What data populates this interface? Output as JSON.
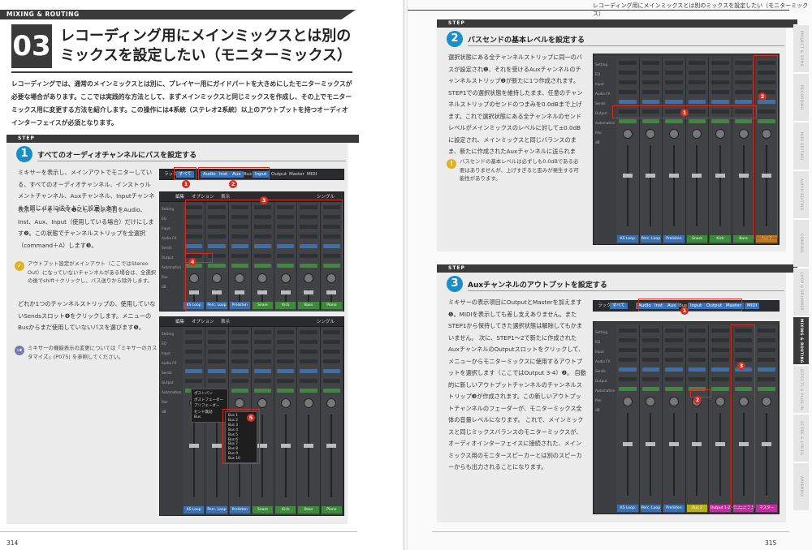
{
  "left_page": {
    "section_label": "MIXING & ROUTING",
    "number": "03",
    "title_line1": "レコーディング用にメインミックスとは別の",
    "title_line2": "ミックスを設定したい（モニターミックス）",
    "intro": "レコーディングでは、通常のメインミックスとは別に、プレイヤー用にガイドパートを大きめにしたモニターミックスが必要な場合があります。ここでは実践的な方法として、まずメインミックスと同じミックスを作成し、その上でモニターミックス用に変更する方法を紹介します。この操作には4系統（ステレオ2系統）以上のアウトプットを持つオーディオインターフェイスが必須となります。",
    "step_label": "STEP",
    "step1": {
      "number": "1",
      "title": "すべてのオーディオチャンネルにバスを設定する",
      "text1": "ミキサーを表示し、メインアウトでモニターしている、すべてのオーディオチャンネル、インストゥルメントチャンネル、Auxチャンネル、Inputチャンネルを同じバスに送るように設定します",
      "text2": "表示モードを すべて❶にし、表示項目をAudio、Inst、Aux、Input（使用している場合）だけにします❷。この状態でチャンネルストリップを全選択（command＋A）します❸。",
      "note1": "アウトプット設定がメインアウト（ここではStereo Out）になっていないチャンネルがある場合は、全選択の後でshift＋クリックし、バス送りから除外します。",
      "text3": "どれか1つのチャンネルストリップの、使用していないSendsスロット❹をクリックします。メニューのBusからまだ使用していないバスを選びます❺。",
      "note2": "ミキサーの機能表示の変更については「ミキサーのカスタマイズ」(P075) を参照してください。"
    },
    "toolbar1": {
      "left": "ラック",
      "all": "すべて",
      "items": [
        "Audio",
        "Inst",
        "Aux",
        "Bus",
        "Input",
        "Output",
        "Master",
        "MIDI"
      ]
    },
    "mixer_menu": {
      "edit": "編集",
      "options": "オプション",
      "view": "表示",
      "single": "シングル"
    },
    "strip_names": [
      "KS Loop",
      "Perc. Loop",
      "Prelisten",
      "Snare",
      "Kick",
      "Bass",
      "Piano"
    ],
    "strip_colors": [
      "#3a6fb0",
      "#3a6fb0",
      "#3a6fb0",
      "#3c8a3a",
      "#3c8a3a",
      "#3c8a3a",
      "#3c8a3a"
    ],
    "bus_menu": [
      "Bus 1",
      "Bus 2",
      "Bus 3",
      "Bus 4",
      "Bus 5",
      "Bus 6",
      "Bus 7",
      "Bus 8",
      "Bus 9",
      "Bus 10"
    ],
    "send_menu": [
      "ポストパン",
      "ポストフェーダー",
      "プリフェーダー",
      "センド無効",
      "Bus"
    ],
    "page_number": "314"
  },
  "right_page": {
    "running_head": "レコーディング用にメインミックスとは別のミックスを設定したい（モニターミックス）",
    "step_label": "STEP",
    "step2": {
      "number": "2",
      "title": "バスセンドの基本レベルを設定する",
      "text": "選択状態にある全チャンネルストリップに同一のバスが設定され❶、それを受けるAuxチャンネルのチャンネルストリップ❷が新たに1つ作成されます。 STEP1での選択状態を維持したまま、任意のチャンネルストリップのセンドのつまみを0.0dBまで上げます。これで選択状態にある全チャンネルのセンドレベルがメインミックスのレベルに対して±0.0dBに設定され、メインミックスと同じバランスのまま、新たに作成されたAuxチャンネルに送られます。",
      "note": "バスセンドの基本レベルは必ずしも0.0dBである必要はありませんが、上げすぎると歪みが発生する可能性があります。"
    },
    "step3": {
      "number": "3",
      "title": "Auxチャンネルのアウトプットを設定する",
      "text": "ミキサーの表示項目にOutputとMasterを加えます❶。MIDIを表示しても差し支えありません。またSTEP1から保持してきた選択状態は解除してもかまいません。 次に、STEP1〜2で新たに作成されたAuxチャンネルのOutputスロットをクリックして、メニューからモニターミックスに使用するアウトプットを選択します（ここではOutput 3-4）❷。 自動的に新しいアウトプットチャンネルのチャンネルストリップ❸が作成されます。この新しいアウトプットチャンネルのフェーダーが、モニターミックス全体の音量レベルになります。 これで、メインミックスと同じミックスバランスのモニターミックスが、オーディオインターフェイスに接続された、メインミックス用のモニタースピーカーとは別のスピーカーからも出力されることになります。"
    },
    "strip_names2": [
      "KS Loop",
      "Perc. Loop",
      "Prelisten",
      "Snare",
      "Kick",
      "Bass",
      "Aux 2"
    ],
    "strip_names3": [
      "KS Loop",
      "Perc. Loop",
      "Prelisten",
      "Aux 2",
      "Output 1-2",
      "Output 3-4",
      "マスター"
    ],
    "strip_colors3": [
      "#3a6fb0",
      "#3a6fb0",
      "#3a6fb0",
      "#b8b020",
      "#c02fa0",
      "#c02fa0",
      "#c02fa0"
    ],
    "output_slot": "Output 3-4",
    "side_tabs": [
      "PROJECT & SONG",
      "RECORDING",
      "MIDI EDITING",
      "AUDIO EDITING",
      "COMPING",
      "LOOP & DRUMMER",
      "MIXING & ROUTING",
      "EFFECTS & PLUG-IN",
      "SCORE & LYRICS",
      "APPENDIX"
    ],
    "page_number": "315"
  }
}
